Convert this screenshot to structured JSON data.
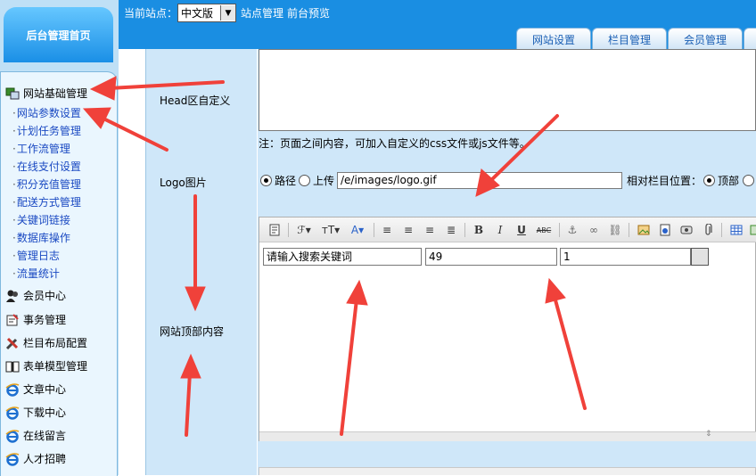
{
  "sidebar": {
    "home_label": "后台管理首页",
    "group_basic": "网站基础管理",
    "sub_items": [
      "网站参数设置",
      "计划任务管理",
      "工作流管理",
      "在线支付设置",
      "积分充值管理",
      "配送方式管理",
      "关键词链接",
      "数据库操作",
      "管理日志",
      "流量统计"
    ],
    "groups": [
      {
        "label": "会员中心",
        "icon": "member-icon"
      },
      {
        "label": "事务管理",
        "icon": "affairs-icon"
      },
      {
        "label": "栏目布局配置",
        "icon": "tools-icon"
      },
      {
        "label": "表单模型管理",
        "icon": "form-book-icon"
      },
      {
        "label": "文章中心",
        "icon": "ie-icon"
      },
      {
        "label": "下载中心",
        "icon": "ie-icon"
      },
      {
        "label": "在线留言",
        "icon": "ie-icon"
      },
      {
        "label": "人才招聘",
        "icon": "ie-icon"
      }
    ]
  },
  "topbar": {
    "current_site_label": "当前站点：",
    "site_value": "中文版",
    "site_manage": "站点管理",
    "front_preview": "前台预览",
    "tabs": [
      "网站设置",
      "栏目管理",
      "会员管理"
    ]
  },
  "form": {
    "head_label": "Head区自定义",
    "head_note": "注：页面之间内容，可加入自定义的css文件或js文件等。",
    "logo_label": "Logo图片",
    "logo_path_label": "路径",
    "logo_upload_label": "上传",
    "logo_value": "/e/images/logo.gif",
    "logo_position_label": "相对栏目位置：",
    "logo_position_top": "顶部",
    "top_content_label": "网站顶部内容",
    "editor_inputs": [
      "请输入搜索关键词",
      "49",
      "1"
    ]
  },
  "colors": {
    "accent": "#1a8ee2",
    "sidebar_bg": "#bfe0f6",
    "panel_bg": "#cfe7f9",
    "link": "#1a49c2",
    "annotation_arrow": "#f0413a"
  }
}
